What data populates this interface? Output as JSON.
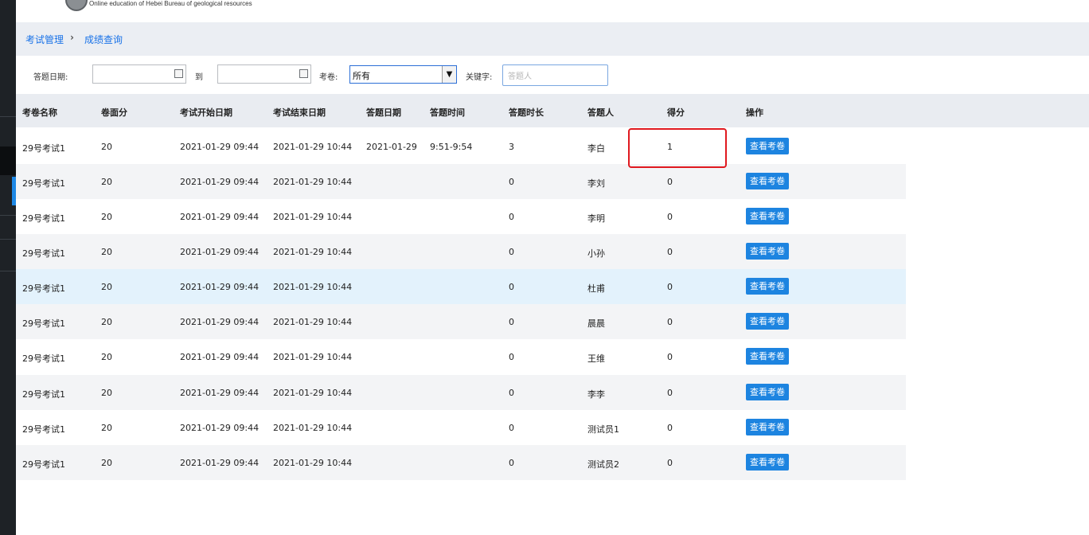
{
  "header": {
    "subtitle": "Online education of Hebei Bureau of geological resources"
  },
  "breadcrumb": {
    "parent": "考试管理",
    "separator": "›",
    "current": "成绩查询"
  },
  "filters": {
    "date_label": "答题日期:",
    "to_label": "到",
    "date_from_value": "",
    "date_to_value": "",
    "paper_label": "考卷:",
    "paper_selected": "所有",
    "keyword_label": "关键字:",
    "keyword_placeholder": "答题人",
    "keyword_value": ""
  },
  "table": {
    "columns": [
      "考卷名称",
      "卷面分",
      "考试开始日期",
      "考试结束日期",
      "答题日期",
      "答题时间",
      "答题时长",
      "答题人",
      "得分",
      "操作"
    ],
    "action_label": "查看考卷",
    "rows": [
      {
        "paper": "29号考试1",
        "total": "20",
        "start": "2021-01-29 09:44",
        "end": "2021-01-29 10:44",
        "date": "2021-01-29",
        "time": "9:51-9:54",
        "duration": "3",
        "person": "李白",
        "score": "1"
      },
      {
        "paper": "29号考试1",
        "total": "20",
        "start": "2021-01-29 09:44",
        "end": "2021-01-29 10:44",
        "date": "",
        "time": "",
        "duration": "0",
        "person": "李刘",
        "score": "0"
      },
      {
        "paper": "29号考试1",
        "total": "20",
        "start": "2021-01-29 09:44",
        "end": "2021-01-29 10:44",
        "date": "",
        "time": "",
        "duration": "0",
        "person": "李明",
        "score": "0"
      },
      {
        "paper": "29号考试1",
        "total": "20",
        "start": "2021-01-29 09:44",
        "end": "2021-01-29 10:44",
        "date": "",
        "time": "",
        "duration": "0",
        "person": "小孙",
        "score": "0"
      },
      {
        "paper": "29号考试1",
        "total": "20",
        "start": "2021-01-29 09:44",
        "end": "2021-01-29 10:44",
        "date": "",
        "time": "",
        "duration": "0",
        "person": "杜甫",
        "score": "0"
      },
      {
        "paper": "29号考试1",
        "total": "20",
        "start": "2021-01-29 09:44",
        "end": "2021-01-29 10:44",
        "date": "",
        "time": "",
        "duration": "0",
        "person": "晨晨",
        "score": "0"
      },
      {
        "paper": "29号考试1",
        "total": "20",
        "start": "2021-01-29 09:44",
        "end": "2021-01-29 10:44",
        "date": "",
        "time": "",
        "duration": "0",
        "person": "王维",
        "score": "0"
      },
      {
        "paper": "29号考试1",
        "total": "20",
        "start": "2021-01-29 09:44",
        "end": "2021-01-29 10:44",
        "date": "",
        "time": "",
        "duration": "0",
        "person": "李李",
        "score": "0"
      },
      {
        "paper": "29号考试1",
        "total": "20",
        "start": "2021-01-29 09:44",
        "end": "2021-01-29 10:44",
        "date": "",
        "time": "",
        "duration": "0",
        "person": "测试员1",
        "score": "0"
      },
      {
        "paper": "29号考试1",
        "total": "20",
        "start": "2021-01-29 09:44",
        "end": "2021-01-29 10:44",
        "date": "",
        "time": "",
        "duration": "0",
        "person": "测试员2",
        "score": "0"
      }
    ]
  },
  "colors": {
    "accent": "#1d84e0",
    "link": "#1a73e8",
    "annotation": "#e0191f"
  }
}
